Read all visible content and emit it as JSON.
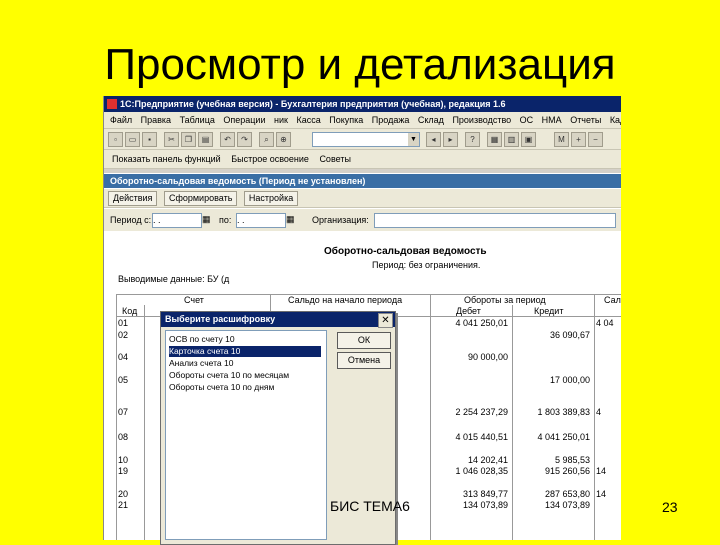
{
  "slide": {
    "title": "Просмотр и детализация",
    "footer": "БИС ТЕМА6",
    "page": "23"
  },
  "window": {
    "title": "1С:Предприятие (учебная версия) - Бухгалтерия предприятия (учебная), редакция 1.6"
  },
  "menu": [
    "Файл",
    "Правка",
    "Таблица",
    "Операции",
    "ник",
    "Касса",
    "Покупка",
    "Продажа",
    "Склад",
    "Производство",
    "ОС",
    "НМА",
    "Отчеты",
    "Кадры"
  ],
  "toolbar2": {
    "show_panel": "Показать панель функций",
    "quick_start": "Быстрое освоение",
    "tips": "Советы"
  },
  "document": {
    "title": "Оборотно-сальдовая ведомость (Период не установлен)",
    "actions_label": "Действия",
    "generate_label": "Сформировать",
    "settings_label": "Настройка",
    "period_label": "Период с:",
    "period_from": ". .",
    "to_label": "по:",
    "period_to": ". .",
    "org_label": "Организация:"
  },
  "report": {
    "title": "Оборотно-сальдовая ведомость",
    "subtitle": "Период: без ограничения.",
    "units": "Выводимые данные: БУ (д",
    "headers": {
      "account": "Счет",
      "code": "Код",
      "opening": "Сальдо на начало периода",
      "turnover": "Обороты за период",
      "debit": "Дебет",
      "credit": "Кредит",
      "closing": "Сал"
    },
    "rows": [
      {
        "code": "01",
        "debit": "4 041 250,01",
        "credit": ""
      },
      {
        "code": "02",
        "debit": "",
        "credit": "36 090,67"
      },
      {
        "code": "04",
        "debit": "90 000,00",
        "credit": ""
      },
      {
        "code": "05",
        "debit": "",
        "credit": "17 000,00"
      },
      {
        "code": "07",
        "debit": "2 254 237,29",
        "credit": "1 803 389,83"
      },
      {
        "code": "08",
        "debit": "4 015 440,51",
        "credit": "4 041 250,01"
      },
      {
        "code": "10",
        "debit": "14 202,41",
        "credit": "5 985,53"
      },
      {
        "code": "19",
        "debit": "1 046 028,35",
        "credit": "915 260,56"
      },
      {
        "code": "20",
        "debit": "313 849,77",
        "credit": "287 653,80"
      },
      {
        "code": "21",
        "debit": "134 073,89",
        "credit": "134 073,89"
      }
    ],
    "closing_fragments": [
      "4 04",
      "4",
      "14",
      "14"
    ]
  },
  "dialog": {
    "title": "Выберите расшифровку",
    "items": [
      "ОСВ по счету 10",
      "Карточка счета 10",
      "Анализ счета 10",
      "Обороты счета 10 по месяцам",
      "Обороты счета 10 по дням"
    ],
    "selected_index": 1,
    "ok_label": "ОК",
    "cancel_label": "Отмена",
    "close_glyph": "✕"
  }
}
